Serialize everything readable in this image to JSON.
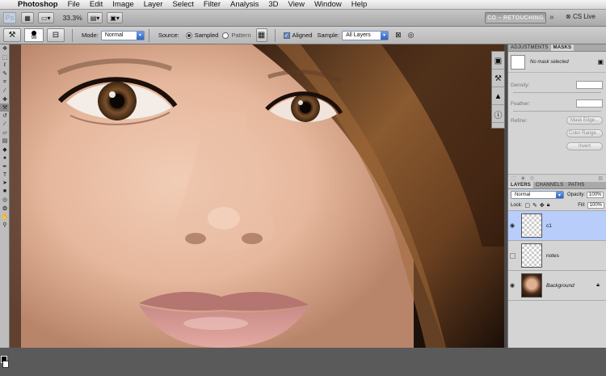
{
  "menubar": {
    "items": [
      "Photoshop",
      "File",
      "Edit",
      "Image",
      "Layer",
      "Select",
      "Filter",
      "Analysis",
      "3D",
      "View",
      "Window",
      "Help"
    ]
  },
  "appbar": {
    "logo": "Ps",
    "zoom": "33.3%",
    "workspace": "CO – RETOUCHING",
    "cslive": "CS Live"
  },
  "options": {
    "brush_size": "98",
    "mode_label": "Mode:",
    "mode_value": "Normal",
    "source_label": "Source:",
    "source_options": [
      "Sampled",
      "Pattern"
    ],
    "aligned_label": "Aligned",
    "sample_label": "Sample:",
    "sample_value": "All Layers"
  },
  "adjust_panel": {
    "tabs": [
      "ADJUSTMENTS",
      "MASKS"
    ],
    "status": "No mask selected",
    "density_label": "Density:",
    "feather_label": "Feather:",
    "refine_label": "Refine:",
    "buttons": [
      "Mask Edge...",
      "Color Range...",
      "Invert"
    ]
  },
  "layers_panel": {
    "tabs": [
      "LAYERS",
      "CHANNELS",
      "PATHS"
    ],
    "blend_mode": "Normal",
    "opacity_label": "Opacity:",
    "opacity_value": "100%",
    "lock_label": "Lock:",
    "fill_label": "Fill:",
    "fill_value": "100%",
    "layers": [
      {
        "name": "c1",
        "selected": true,
        "visible": true
      },
      {
        "name": "notes",
        "selected": false,
        "visible": false
      },
      {
        "name": "Background",
        "selected": false,
        "visible": true
      }
    ]
  },
  "colors": {
    "selection": "#b8cdfa",
    "accent": "#2f63c0"
  }
}
